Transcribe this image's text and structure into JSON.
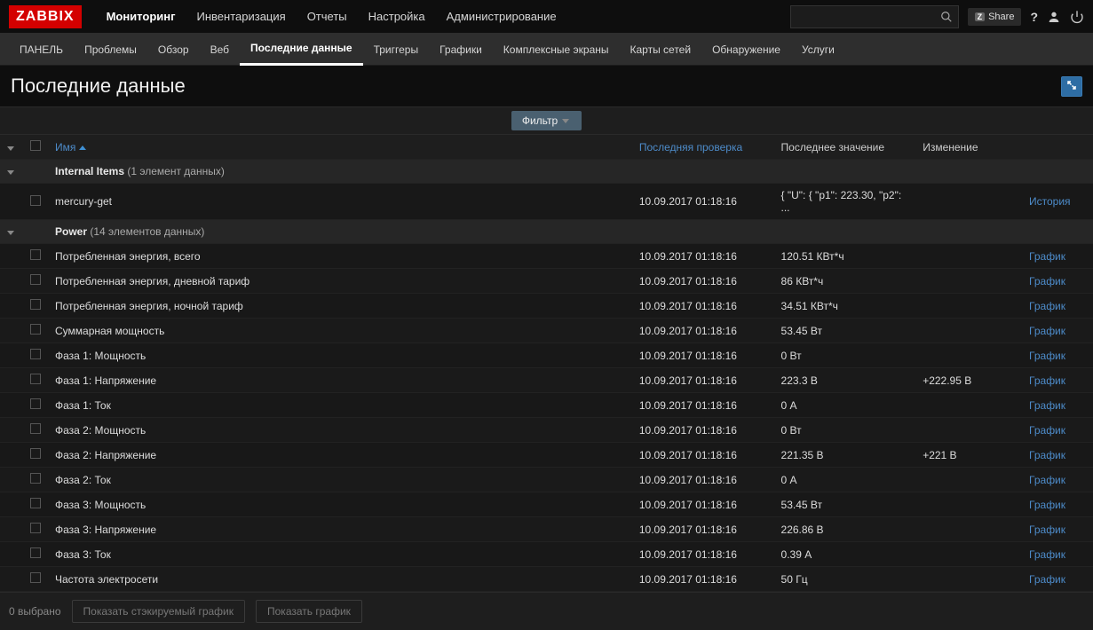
{
  "logo": "ZABBIX",
  "top_nav": [
    {
      "label": "Мониторинг",
      "active": true
    },
    {
      "label": "Инвентаризация",
      "active": false
    },
    {
      "label": "Отчеты",
      "active": false
    },
    {
      "label": "Настройка",
      "active": false
    },
    {
      "label": "Администрирование",
      "active": false
    }
  ],
  "share_label": "Share",
  "sub_nav": [
    {
      "label": "ПАНЕЛЬ",
      "active": false
    },
    {
      "label": "Проблемы",
      "active": false
    },
    {
      "label": "Обзор",
      "active": false
    },
    {
      "label": "Веб",
      "active": false
    },
    {
      "label": "Последние данные",
      "active": true
    },
    {
      "label": "Триггеры",
      "active": false
    },
    {
      "label": "Графики",
      "active": false
    },
    {
      "label": "Комплексные экраны",
      "active": false
    },
    {
      "label": "Карты сетей",
      "active": false
    },
    {
      "label": "Обнаружение",
      "active": false
    },
    {
      "label": "Услуги",
      "active": false
    }
  ],
  "page_title": "Последние данные",
  "filter_label": "Фильтр",
  "columns": {
    "name": "Имя",
    "last_check": "Последняя проверка",
    "last_value": "Последнее значение",
    "change": "Изменение"
  },
  "groups": [
    {
      "name": "Internal Items",
      "count_label": "(1 элемент данных)",
      "items": [
        {
          "name": "mercury-get",
          "last_check": "10.09.2017 01:18:16",
          "last_value": "{ \"U\": { \"p1\": 223.30, \"p2\": ...",
          "change": "",
          "action": "История"
        }
      ]
    },
    {
      "name": "Power",
      "count_label": "(14 элементов данных)",
      "items": [
        {
          "name": "Потребленная энергия, всего",
          "last_check": "10.09.2017 01:18:16",
          "last_value": "120.51 КВт*ч",
          "change": "",
          "action": "График"
        },
        {
          "name": "Потребленная энергия, дневной тариф",
          "last_check": "10.09.2017 01:18:16",
          "last_value": "86 КВт*ч",
          "change": "",
          "action": "График"
        },
        {
          "name": "Потребленная энергия, ночной тариф",
          "last_check": "10.09.2017 01:18:16",
          "last_value": "34.51 КВт*ч",
          "change": "",
          "action": "График"
        },
        {
          "name": "Суммарная мощность",
          "last_check": "10.09.2017 01:18:16",
          "last_value": "53.45 Вт",
          "change": "",
          "action": "График"
        },
        {
          "name": "Фаза 1: Мощность",
          "last_check": "10.09.2017 01:18:16",
          "last_value": "0 Вт",
          "change": "",
          "action": "График"
        },
        {
          "name": "Фаза 1: Напряжение",
          "last_check": "10.09.2017 01:18:16",
          "last_value": "223.3 В",
          "change": "+222.95 В",
          "action": "График"
        },
        {
          "name": "Фаза 1: Ток",
          "last_check": "10.09.2017 01:18:16",
          "last_value": "0 А",
          "change": "",
          "action": "График"
        },
        {
          "name": "Фаза 2: Мощность",
          "last_check": "10.09.2017 01:18:16",
          "last_value": "0 Вт",
          "change": "",
          "action": "График"
        },
        {
          "name": "Фаза 2: Напряжение",
          "last_check": "10.09.2017 01:18:16",
          "last_value": "221.35 В",
          "change": "+221 В",
          "action": "График"
        },
        {
          "name": "Фаза 2: Ток",
          "last_check": "10.09.2017 01:18:16",
          "last_value": "0 А",
          "change": "",
          "action": "График"
        },
        {
          "name": "Фаза 3: Мощность",
          "last_check": "10.09.2017 01:18:16",
          "last_value": "53.45 Вт",
          "change": "",
          "action": "График"
        },
        {
          "name": "Фаза 3: Напряжение",
          "last_check": "10.09.2017 01:18:16",
          "last_value": "226.86 В",
          "change": "",
          "action": "График"
        },
        {
          "name": "Фаза 3: Ток",
          "last_check": "10.09.2017 01:18:16",
          "last_value": "0.39 А",
          "change": "",
          "action": "График"
        },
        {
          "name": "Частота электросети",
          "last_check": "10.09.2017 01:18:16",
          "last_value": "50 Гц",
          "change": "",
          "action": "График"
        }
      ]
    }
  ],
  "footer": {
    "selected_label": "0 выбрано",
    "stacked_btn": "Показать стэкируемый график",
    "graph_btn": "Показать график"
  }
}
